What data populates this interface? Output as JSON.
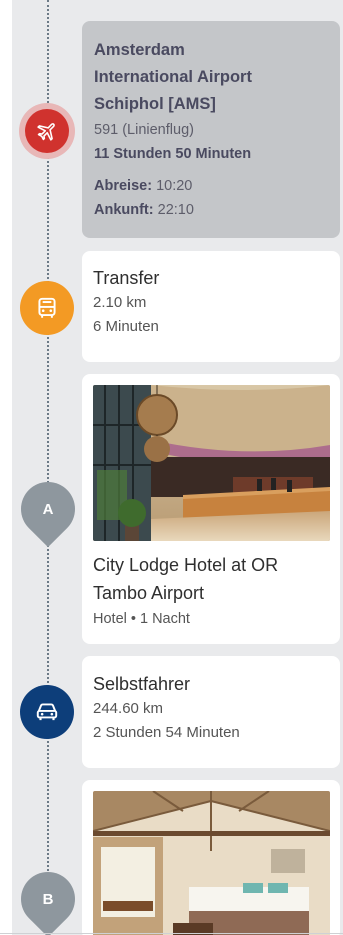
{
  "flight": {
    "title_lines": [
      "Amsterdam",
      "International Airport",
      "Schiphol [AMS]"
    ],
    "flight_info": "591 (Linienflug)",
    "duration": "11 Stunden 50 Minuten",
    "departure_label": "Abreise:",
    "departure_time": "10:20",
    "arrival_label": "Ankunft:",
    "arrival_time": "22:10",
    "marker_color": "#d0322e"
  },
  "transfer": {
    "title": "Transfer",
    "distance": "2.10 km",
    "duration": "6 Minuten",
    "marker_color": "#f39a24"
  },
  "hotel1": {
    "pin_letter": "A",
    "name_lines": [
      "City Lodge Hotel at OR",
      "Tambo Airport"
    ],
    "details": "Hotel • 1 Nacht"
  },
  "selfdrive": {
    "title": "Selbstfahrer",
    "distance": "244.60 km",
    "duration": "2 Stunden 54 Minuten",
    "marker_color": "#0d3e7a"
  },
  "hotel2": {
    "pin_letter": "B"
  },
  "icons": {
    "flight": "airplane-icon",
    "transfer": "bus-icon",
    "selfdrive": "car-icon"
  }
}
